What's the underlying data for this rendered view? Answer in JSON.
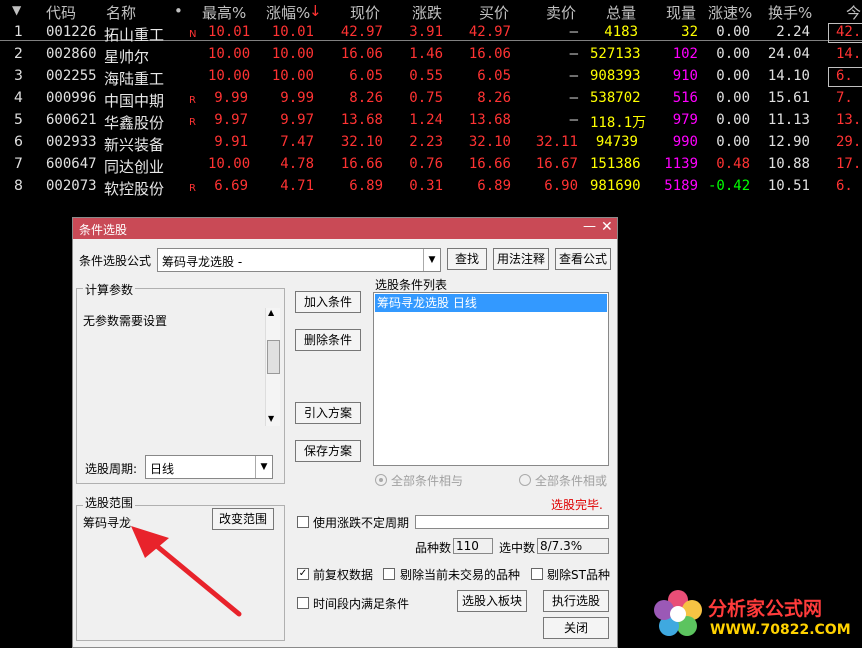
{
  "table": {
    "headers": {
      "code": "代码",
      "name": "名称",
      "dot": "•",
      "high": "最高%",
      "change_pct": "涨幅%",
      "sort_arrow": "↓",
      "price": "现价",
      "change": "涨跌",
      "bid": "买价",
      "ask": "卖价",
      "volume": "总量",
      "cur_vol": "现量",
      "speed": "涨速%",
      "turnover": "换手%",
      "more": "今"
    },
    "rows": [
      {
        "idx": "1",
        "code": "001226",
        "name": "拓山重工",
        "flag": "N",
        "high": "10.01",
        "pct": "10.01",
        "price": "42.97",
        "chg": "3.91",
        "bid": "42.97",
        "ask": "–",
        "vol": "4183",
        "cur": "32",
        "speed": "0.00",
        "turn": "2.24",
        "today": "42."
      },
      {
        "idx": "2",
        "code": "002860",
        "name": "星帅尔",
        "flag": "",
        "high": "10.00",
        "pct": "10.00",
        "price": "16.06",
        "chg": "1.46",
        "bid": "16.06",
        "ask": "–",
        "vol": "527133",
        "cur": "102",
        "speed": "0.00",
        "turn": "24.04",
        "today": "14."
      },
      {
        "idx": "3",
        "code": "002255",
        "name": "海陆重工",
        "flag": "",
        "high": "10.00",
        "pct": "10.00",
        "price": "6.05",
        "chg": "0.55",
        "bid": "6.05",
        "ask": "–",
        "vol": "908393",
        "cur": "910",
        "speed": "0.00",
        "turn": "14.10",
        "today": "6."
      },
      {
        "idx": "4",
        "code": "000996",
        "name": "中国中期",
        "flag": "R",
        "high": "9.99",
        "pct": "9.99",
        "price": "8.26",
        "chg": "0.75",
        "bid": "8.26",
        "ask": "–",
        "vol": "538702",
        "cur": "516",
        "speed": "0.00",
        "turn": "15.61",
        "today": "7."
      },
      {
        "idx": "5",
        "code": "600621",
        "name": "华鑫股份",
        "flag": "R",
        "high": "9.97",
        "pct": "9.97",
        "price": "13.68",
        "chg": "1.24",
        "bid": "13.68",
        "ask": "–",
        "vol": "118.1万",
        "cur": "979",
        "speed": "0.00",
        "turn": "11.13",
        "today": "13."
      },
      {
        "idx": "6",
        "code": "002933",
        "name": "新兴装备",
        "flag": "",
        "high": "9.91",
        "pct": "7.47",
        "price": "32.10",
        "chg": "2.23",
        "bid": "32.10",
        "ask": "32.11",
        "vol": "94739",
        "cur": "990",
        "speed": "0.00",
        "turn": "12.90",
        "today": "29."
      },
      {
        "idx": "7",
        "code": "600647",
        "name": "同达创业",
        "flag": "",
        "high": "10.00",
        "pct": "4.78",
        "price": "16.66",
        "chg": "0.76",
        "bid": "16.66",
        "ask": "16.67",
        "vol": "151386",
        "cur": "1139",
        "speed": "0.48",
        "turn": "10.88",
        "today": "17."
      },
      {
        "idx": "8",
        "code": "002073",
        "name": "软控股份",
        "flag": "R",
        "high": "6.69",
        "pct": "4.71",
        "price": "6.89",
        "chg": "0.31",
        "bid": "6.89",
        "ask": "6.90",
        "vol": "981690",
        "cur": "5189",
        "speed": "-0.42",
        "turn": "10.51",
        "today": "6."
      }
    ]
  },
  "dialog": {
    "title": "条件选股",
    "formula_label": "条件选股公式",
    "formula_value": "筹码寻龙选股 -",
    "find": "查找",
    "usage": "用法注释",
    "view_formula": "查看公式",
    "params_group": "计算参数",
    "params_text": "无参数需要设置",
    "add": "加入条件",
    "delete": "删除条件",
    "import": "引入方案",
    "save": "保存方案",
    "list_label": "选股条件列表",
    "list_item": "筹码寻龙选股  日线",
    "period_label": "选股周期:",
    "period_value": "日线",
    "radio_and": "全部条件相与",
    "radio_or": "全部条件相或",
    "status": "选股完毕.",
    "range_group": "选股范围",
    "range_value": "筹码寻龙",
    "change_range": "改变范围",
    "use_uncertain": "使用涨跌不定周期",
    "count_label": "品种数",
    "count_value": "110",
    "selected_label": "选中数",
    "selected_value": "8/7.3%",
    "fq": "前复权数据",
    "remove_suspended": "剔除当前未交易的品种",
    "remove_st": "剔除ST品种",
    "time_range": "时间段内满足条件",
    "to_block": "选股入板块",
    "execute": "执行选股",
    "close": "关闭"
  },
  "watermark": {
    "line1": "分析家公式网",
    "line2": "WWW.70822.COM"
  }
}
